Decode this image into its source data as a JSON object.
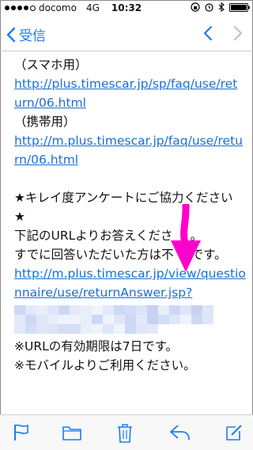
{
  "status_bar": {
    "carrier": "docomo",
    "network": "4G",
    "time": "10:32"
  },
  "nav": {
    "back_label": "受信"
  },
  "message": {
    "lines": [
      {
        "text": "（スマホ用）",
        "type": "text"
      },
      {
        "text": "http://plus.timescar.jp/sp/faq/use/ret",
        "type": "link"
      },
      {
        "text": "urn/06.html",
        "type": "link"
      },
      {
        "text": "（携帯用）",
        "type": "text"
      },
      {
        "text": "http://m.plus.timescar.jp/faq/use/retu",
        "type": "link"
      },
      {
        "text": "rn/06.html",
        "type": "link"
      },
      {
        "text": "",
        "type": "spacer"
      },
      {
        "text": "★キレイ度アンケートにご協力ください",
        "type": "text"
      },
      {
        "text": "★",
        "type": "text"
      },
      {
        "text": "下記のURLよりお答えくださ",
        "type": "text"
      },
      {
        "text": "すでに回答いただいた方は不",
        "type": "text"
      },
      {
        "text": "http://m.plus.timescar.jp/view/questio",
        "type": "link"
      },
      {
        "text": "nnaire/use/returnAnswer.jsp?",
        "type": "link"
      }
    ],
    "after_blur": [
      "※URLの有効期限は7日です。",
      "※モバイルよりご利用ください。"
    ],
    "line9_suffix": "。",
    "line10_suffix": "です。"
  },
  "colors": {
    "link": "#1a6fd6",
    "accent": "#1a7cf5",
    "arrow": "#ff00cc"
  },
  "toolbar": {
    "icons": [
      "flag-icon",
      "folder-icon",
      "trash-icon",
      "reply-icon",
      "compose-icon"
    ]
  }
}
